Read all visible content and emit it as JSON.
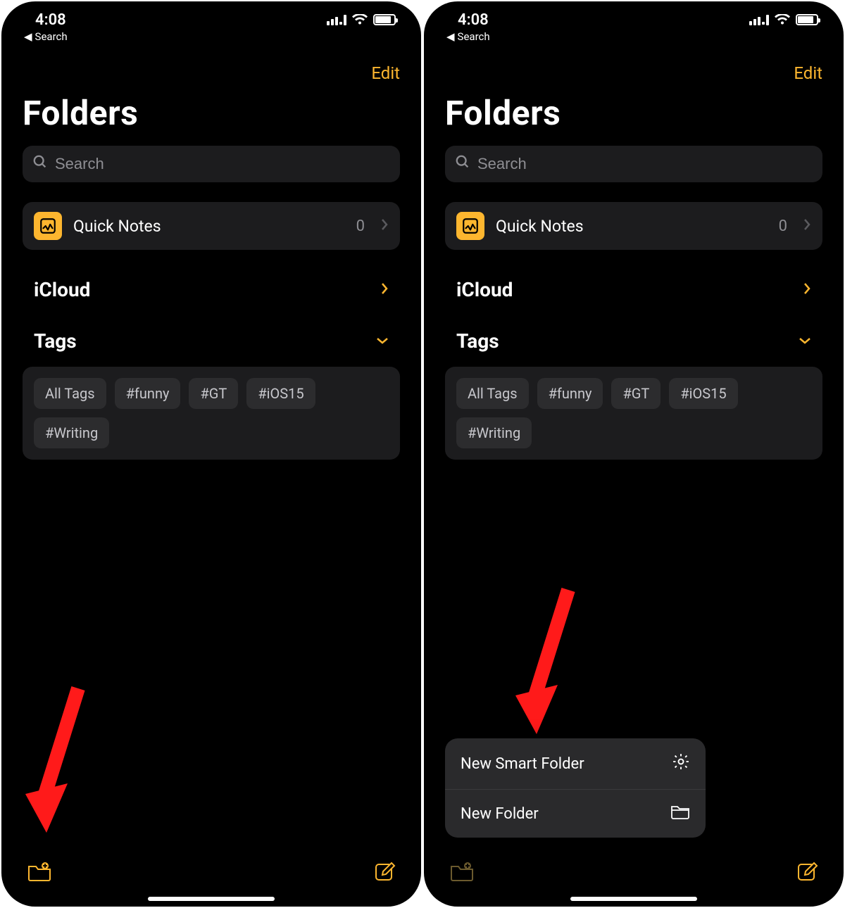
{
  "status": {
    "time": "4:08",
    "backLabel": "Search"
  },
  "nav": {
    "edit": "Edit"
  },
  "title": "Folders",
  "search": {
    "placeholder": "Search"
  },
  "quickNotes": {
    "label": "Quick Notes",
    "count": "0"
  },
  "sections": {
    "icloud": "iCloud",
    "tags": "Tags"
  },
  "tags": [
    "All Tags",
    "#funny",
    "#GT",
    "#iOS15",
    "#Writing"
  ],
  "popup": {
    "smartFolder": "New Smart Folder",
    "newFolder": "New Folder"
  }
}
